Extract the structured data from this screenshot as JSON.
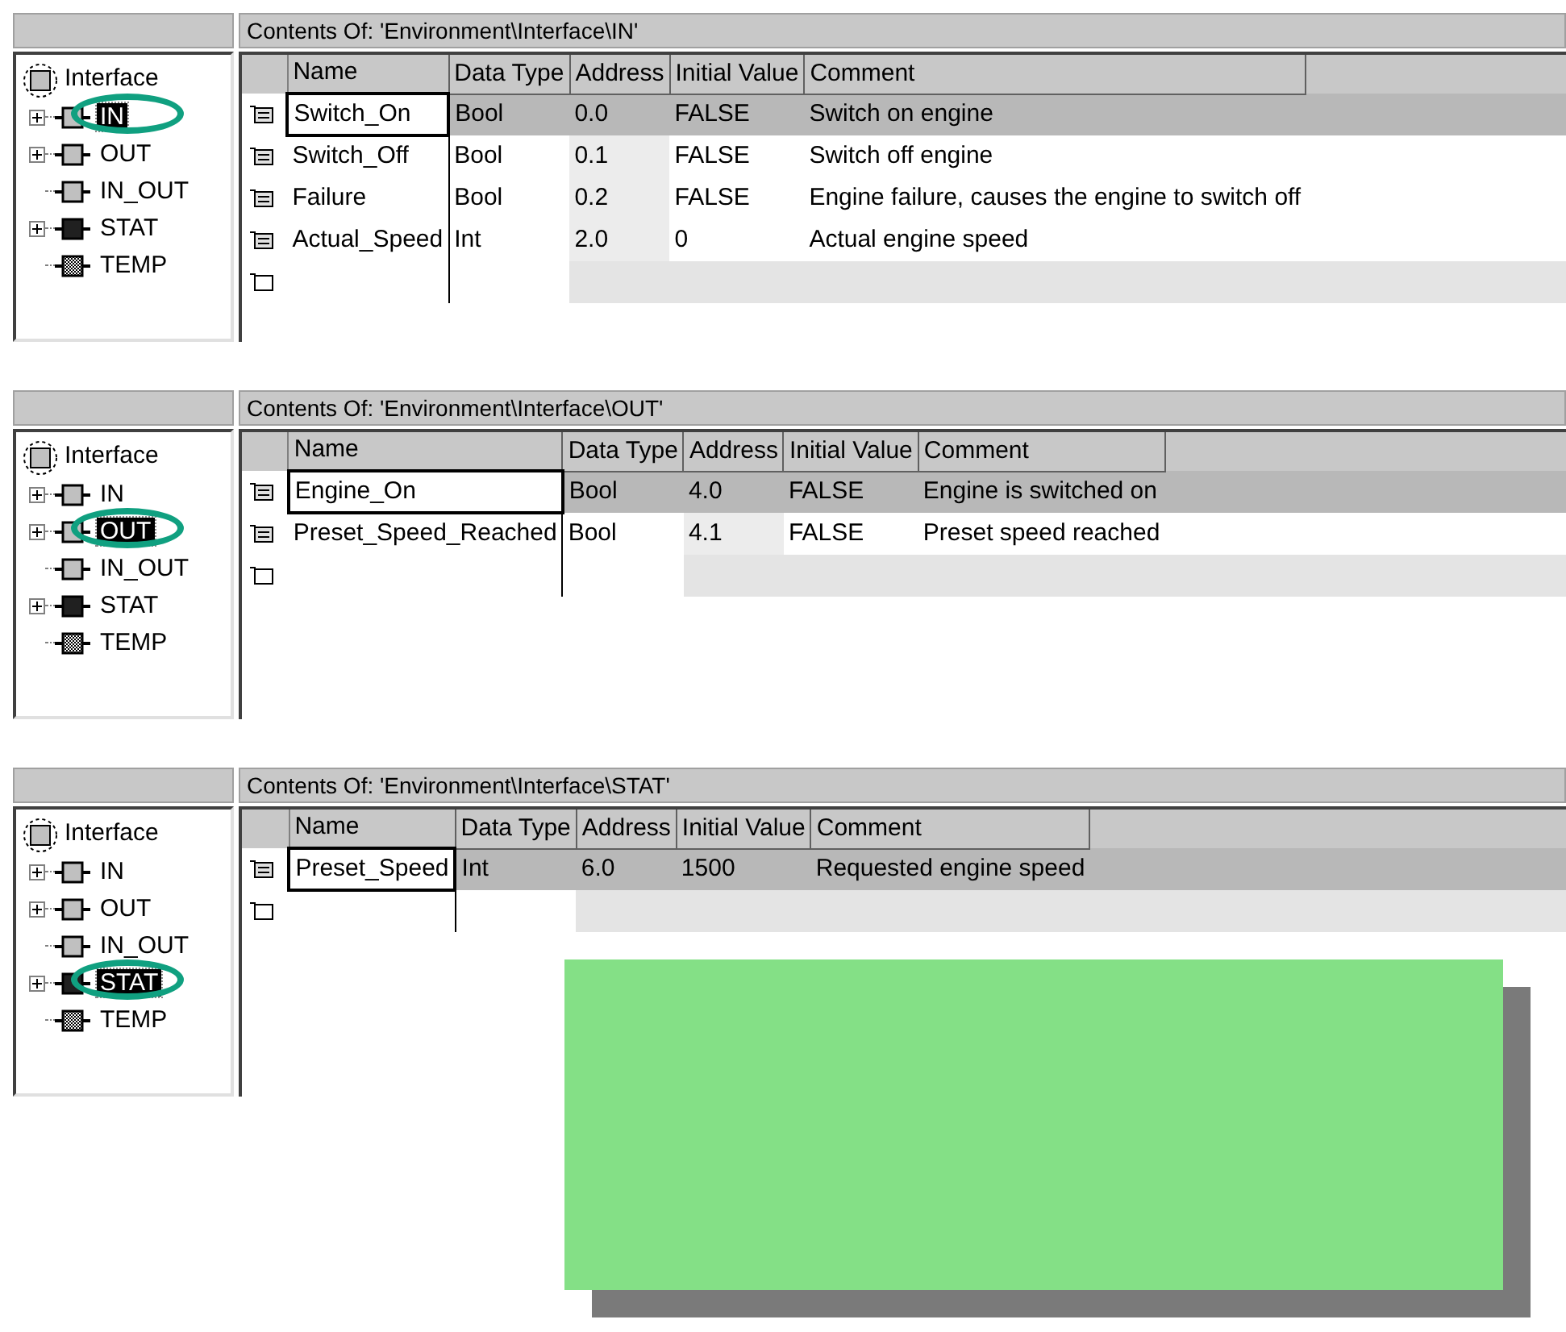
{
  "panels": [
    {
      "tree": {
        "root": "Interface",
        "items": [
          {
            "label": "IN",
            "kind": "in",
            "collapsible": true,
            "selected": true
          },
          {
            "label": "OUT",
            "kind": "out",
            "collapsible": true,
            "selected": false
          },
          {
            "label": "IN_OUT",
            "kind": "inout",
            "collapsible": false,
            "selected": false
          },
          {
            "label": "STAT",
            "kind": "stat",
            "collapsible": true,
            "selected": false
          },
          {
            "label": "TEMP",
            "kind": "temp",
            "collapsible": false,
            "selected": false
          }
        ]
      },
      "contents_title": "Contents Of: 'Environment\\Interface\\IN'",
      "columns": [
        "Name",
        "Data Type",
        "Address",
        "Initial Value",
        "Comment"
      ],
      "rows": [
        {
          "selected": true,
          "cells": [
            "Switch_On",
            "Bool",
            "0.0",
            "FALSE",
            "Switch on engine"
          ]
        },
        {
          "selected": false,
          "cells": [
            "Switch_Off",
            "Bool",
            "0.1",
            "FALSE",
            "Switch off engine"
          ]
        },
        {
          "selected": false,
          "cells": [
            "Failure",
            "Bool",
            "0.2",
            "FALSE",
            "Engine failure, causes the engine to switch off"
          ]
        },
        {
          "selected": false,
          "cells": [
            "Actual_Speed",
            "Int",
            "2.0",
            "0",
            "Actual engine speed"
          ]
        }
      ]
    },
    {
      "tree": {
        "root": "Interface",
        "items": [
          {
            "label": "IN",
            "kind": "in",
            "collapsible": true,
            "selected": false
          },
          {
            "label": "OUT",
            "kind": "out",
            "collapsible": true,
            "selected": true
          },
          {
            "label": "IN_OUT",
            "kind": "inout",
            "collapsible": false,
            "selected": false
          },
          {
            "label": "STAT",
            "kind": "stat",
            "collapsible": true,
            "selected": false
          },
          {
            "label": "TEMP",
            "kind": "temp",
            "collapsible": false,
            "selected": false
          }
        ]
      },
      "contents_title": "Contents Of: 'Environment\\Interface\\OUT'",
      "columns": [
        "Name",
        "Data Type",
        "Address",
        "Initial Value",
        "Comment"
      ],
      "rows": [
        {
          "selected": true,
          "cells": [
            "Engine_On",
            "Bool",
            "4.0",
            "FALSE",
            "Engine is switched on"
          ]
        },
        {
          "selected": false,
          "cells": [
            "Preset_Speed_Reached",
            "Bool",
            "4.1",
            "FALSE",
            "Preset speed reached"
          ]
        }
      ]
    },
    {
      "tree": {
        "root": "Interface",
        "items": [
          {
            "label": "IN",
            "kind": "in",
            "collapsible": true,
            "selected": false
          },
          {
            "label": "OUT",
            "kind": "out",
            "collapsible": true,
            "selected": false
          },
          {
            "label": "IN_OUT",
            "kind": "inout",
            "collapsible": false,
            "selected": false
          },
          {
            "label": "STAT",
            "kind": "stat",
            "collapsible": true,
            "selected": true
          },
          {
            "label": "TEMP",
            "kind": "temp",
            "collapsible": false,
            "selected": false
          }
        ]
      },
      "contents_title": "Contents Of: 'Environment\\Interface\\STAT'",
      "columns": [
        "Name",
        "Data Type",
        "Address",
        "Initial Value",
        "Comment"
      ],
      "rows": [
        {
          "selected": true,
          "cells": [
            "Preset_Speed",
            "Int",
            "6.0",
            "1500",
            "Requested engine speed"
          ]
        }
      ]
    }
  ],
  "callout": {
    "shown": true
  }
}
